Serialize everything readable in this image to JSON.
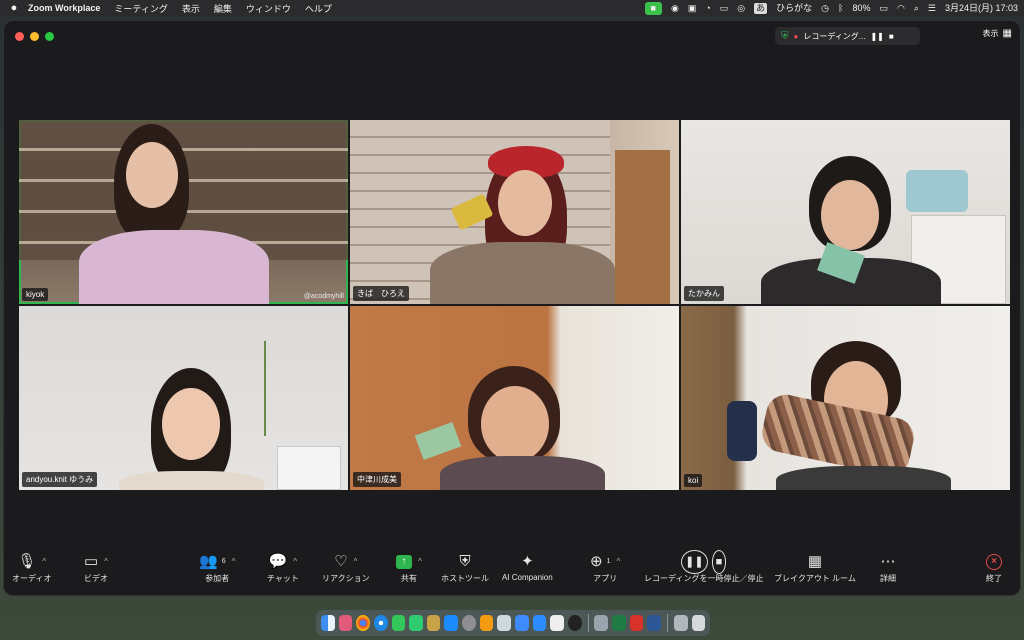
{
  "menubar": {
    "app_name": "Zoom Workplace",
    "menus": [
      "ミーティング",
      "表示",
      "編集",
      "ウィンドウ",
      "ヘルプ"
    ],
    "input_method": "ひらがな",
    "input_badge": "あ",
    "battery": "80%",
    "datetime": "3月24日(月)  17:03"
  },
  "titlebar": {
    "recording_label": "レコーディング...",
    "view_label": "表示"
  },
  "participants": [
    {
      "name": "kiyok",
      "watermark": "@acodmyhill"
    },
    {
      "name": "きば　ひろえ"
    },
    {
      "name": "たかみん"
    },
    {
      "name": "andyou.knit ゆうみ"
    },
    {
      "name": "中津川成美"
    },
    {
      "name": "koi"
    }
  ],
  "toolbar": {
    "audio": "オーディオ",
    "video": "ビデオ",
    "participants": "参加者",
    "participants_count": "6",
    "chat": "チャット",
    "reactions": "リアクション",
    "share": "共有",
    "host_tools": "ホストツール",
    "ai_companion": "AI Companion",
    "apps": "アプリ",
    "apps_count": "1",
    "recording": "レコーディングを一時停止／停止",
    "breakout": "ブレイクアウト ルーム",
    "more": "詳細",
    "end": "終了"
  },
  "colors": {
    "accent_green": "#2fb64f",
    "end_red": "#e5484d",
    "window_bg": "#1b1b1d"
  }
}
